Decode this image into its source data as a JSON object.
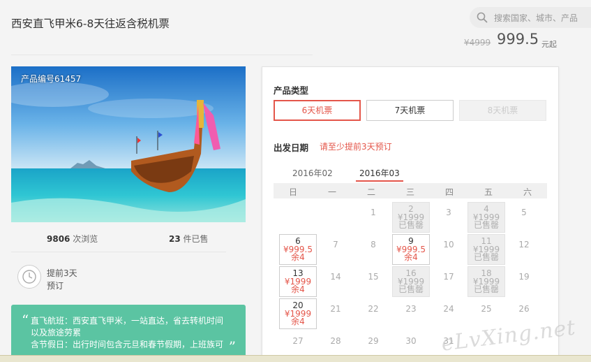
{
  "header": {
    "title": "西安直飞甲米6-8天往返含税机票",
    "search_placeholder": "搜索国家、城市、产品",
    "original_price": "¥4999",
    "price": "999.5",
    "price_suffix": "元起"
  },
  "product": {
    "number": "产品编号61457",
    "views_count": "9806",
    "views_label": " 次浏览",
    "sold_count": "23",
    "sold_label": " 件已售",
    "advance_line1": "提前3天",
    "advance_line2": "预订"
  },
  "highlights": {
    "line1": "直飞航班：西安直飞甲米，一站直达，省去转机时间",
    "line2": "以及旅途劳累",
    "line3": "含节假日：出行时间包含元旦和春节假期，上班族可"
  },
  "booking": {
    "type_label": "产品类型",
    "types": [
      "6天机票",
      "7天机票",
      "8天机票"
    ],
    "date_label": "出发日期",
    "date_hint": "请至少提前3天预订",
    "months": [
      "2016年02",
      "2016年03"
    ],
    "weekdays": [
      "日",
      "一",
      "二",
      "三",
      "四",
      "五",
      "六"
    ],
    "calendar": [
      {
        "day": "1",
        "state": "out"
      },
      {
        "day": "2",
        "state": "sold",
        "price": "¥1999",
        "stock": "已售罄"
      },
      {
        "day": "3",
        "state": "out"
      },
      {
        "day": "4",
        "state": "sold",
        "price": "¥1999",
        "stock": "已售罄"
      },
      {
        "day": "5",
        "state": "out"
      },
      {
        "day": "6",
        "state": "avail",
        "price": "¥999.5",
        "stock": "余4"
      },
      {
        "day": "7",
        "state": "out"
      },
      {
        "day": "8",
        "state": "out"
      },
      {
        "day": "9",
        "state": "avail",
        "price": "¥999.5",
        "stock": "余4"
      },
      {
        "day": "10",
        "state": "out"
      },
      {
        "day": "11",
        "state": "sold",
        "price": "¥1999",
        "stock": "已售罄"
      },
      {
        "day": "12",
        "state": "out"
      },
      {
        "day": "13",
        "state": "avail",
        "price": "¥1999",
        "stock": "余4"
      },
      {
        "day": "14",
        "state": "out"
      },
      {
        "day": "15",
        "state": "out"
      },
      {
        "day": "16",
        "state": "sold",
        "price": "¥1999",
        "stock": "已售罄"
      },
      {
        "day": "17",
        "state": "out"
      },
      {
        "day": "18",
        "state": "sold",
        "price": "¥1999",
        "stock": "已售罄"
      },
      {
        "day": "19",
        "state": "out"
      },
      {
        "day": "20",
        "state": "avail",
        "price": "¥1999",
        "stock": "余4"
      },
      {
        "day": "21",
        "state": "out"
      },
      {
        "day": "22",
        "state": "out"
      },
      {
        "day": "23",
        "state": "out"
      },
      {
        "day": "24",
        "state": "out"
      },
      {
        "day": "25",
        "state": "out"
      },
      {
        "day": "26",
        "state": "out"
      },
      {
        "day": "27",
        "state": "out"
      },
      {
        "day": "28",
        "state": "out"
      },
      {
        "day": "29",
        "state": "out"
      },
      {
        "day": "30",
        "state": "out"
      },
      {
        "day": "31",
        "state": "out"
      }
    ]
  },
  "watermark": "eLvXing.net",
  "accent_color": "#e4564a",
  "green_color": "#5bc4a2"
}
